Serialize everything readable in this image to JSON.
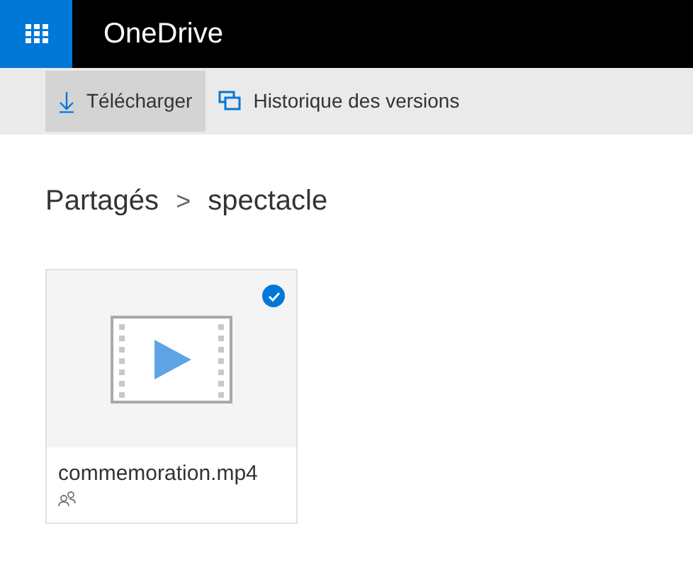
{
  "header": {
    "title": "OneDrive"
  },
  "commands": [
    {
      "label": "Télécharger",
      "kind": "download",
      "selected": true
    },
    {
      "label": "Historique des versions",
      "kind": "versions",
      "selected": false
    }
  ],
  "breadcrumb": {
    "items": [
      "Partagés",
      "spectacle"
    ],
    "separator": ">"
  },
  "files": [
    {
      "name": "commemoration.mp4",
      "kind": "video",
      "selected": true,
      "shared": true
    }
  ]
}
